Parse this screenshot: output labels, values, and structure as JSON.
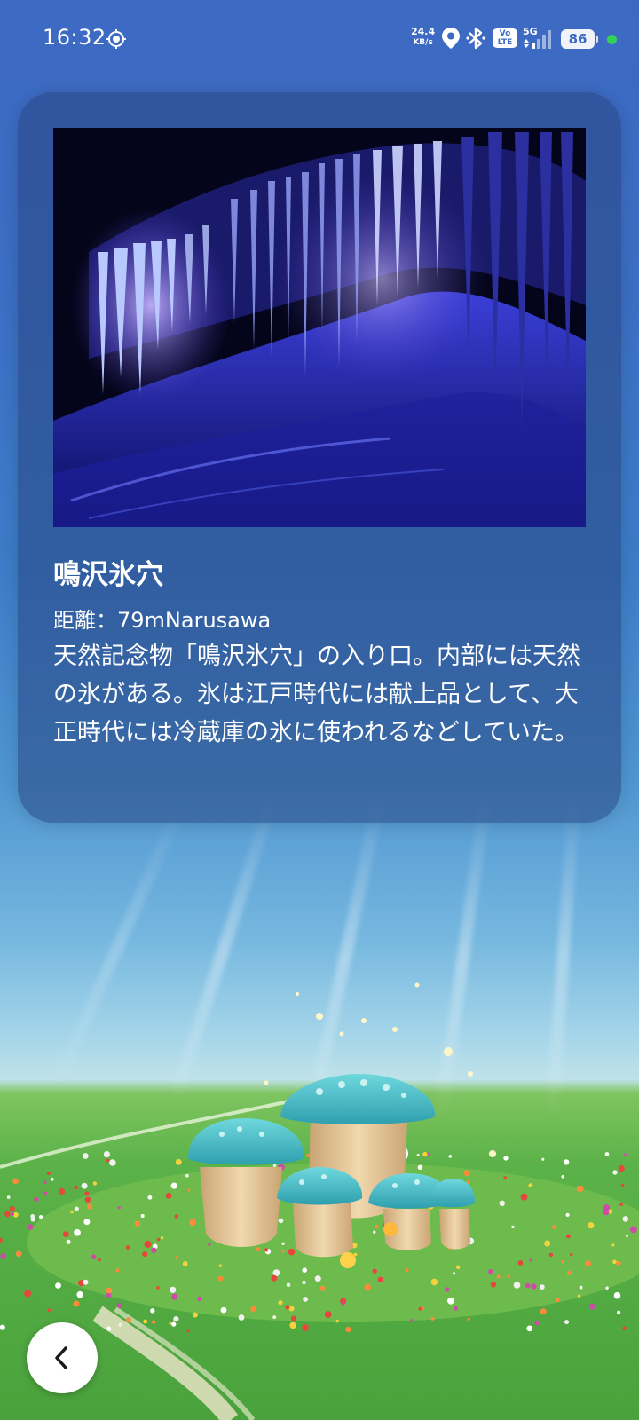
{
  "status_bar": {
    "time": "16:32",
    "net_speed_value": "24.4",
    "net_speed_unit": "KB/s",
    "volte_top": "Vo",
    "volte_bottom": "LTE",
    "network": "5G",
    "battery": "86"
  },
  "spot": {
    "title": "鳴沢氷穴",
    "distance": "距離：79mNarusawa",
    "description": "天然記念物「鳴沢氷穴」の入り口。内部には天然の氷がある。氷は江戸時代には献上品として、大正時代には冷蔵庫の氷に使われるなどしていた。"
  },
  "icons": {
    "location_mode": "location-target-icon",
    "location_pin": "location-pin-icon",
    "bluetooth": "bluetooth-icon",
    "signal": "signal-bars-icon",
    "back": "chevron-left-icon"
  },
  "colors": {
    "sky_top": "#3d69c2",
    "card_bg": "rgba(40,70,130,0.55)",
    "mushroom_cap": "#3fb8c4",
    "grass": "#5bb248",
    "battery_dot": "#35d05a"
  }
}
